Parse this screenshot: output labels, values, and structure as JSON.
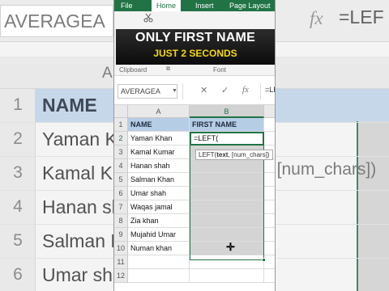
{
  "overlay": {
    "title": "ONLY FIRST NAME",
    "subtitle": "JUST 2 SECONDS",
    "title_color": "#ffffff",
    "subtitle_color": "#f5d90a"
  },
  "ribbon": {
    "tabs": [
      "File",
      "Home",
      "Insert",
      "Page Layout"
    ],
    "active_tab": "Home",
    "groups": [
      "Clipboard",
      "Font"
    ]
  },
  "formula_bar": {
    "name_box": "AVERAGEA",
    "cancel_icon": "✕",
    "enter_icon": "✓",
    "fx_label": "fx",
    "formula": "=LE"
  },
  "sheet": {
    "columns": [
      "A",
      "B"
    ],
    "selected_column": "B",
    "rows": [
      {
        "n": "1",
        "a": "NAME",
        "b": "FIRST NAME"
      },
      {
        "n": "2",
        "a": "Yaman Khan",
        "b": "=LEFT("
      },
      {
        "n": "3",
        "a": "Kamal Kumar",
        "b": ""
      },
      {
        "n": "4",
        "a": "Hanan shah",
        "b": ""
      },
      {
        "n": "5",
        "a": "Salman Khan",
        "b": ""
      },
      {
        "n": "6",
        "a": "Umar shah",
        "b": ""
      },
      {
        "n": "7",
        "a": "Waqas jamal",
        "b": ""
      },
      {
        "n": "8",
        "a": "Zia khan",
        "b": ""
      },
      {
        "n": "9",
        "a": "Mujahid Umar",
        "b": ""
      },
      {
        "n": "10",
        "a": "Numan khan",
        "b": ""
      },
      {
        "n": "11",
        "a": "",
        "b": ""
      },
      {
        "n": "12",
        "a": "",
        "b": ""
      }
    ],
    "active_cell": "B2",
    "tooltip": {
      "func": "LEFT(",
      "arg1": "text",
      "rest": ", [num_chars])"
    }
  },
  "background": {
    "name_box": "AVERAGEA",
    "fx_label": "fx",
    "formula": "=LEF",
    "col_a": "A",
    "rows": [
      {
        "n": "1",
        "a": "NAME"
      },
      {
        "n": "2",
        "a": "Yaman Khan"
      },
      {
        "n": "3",
        "a": "Kamal Ku"
      },
      {
        "n": "4",
        "a": "Hanan shah"
      },
      {
        "n": "5",
        "a": "Salman Kh"
      },
      {
        "n": "6",
        "a": "Umar sha"
      }
    ],
    "tooltip_fragment": ", [num_chars])"
  },
  "colors": {
    "excel_green": "#217346",
    "header_fill": "#b6cde6",
    "selection_fill": "#d4d4d4"
  }
}
